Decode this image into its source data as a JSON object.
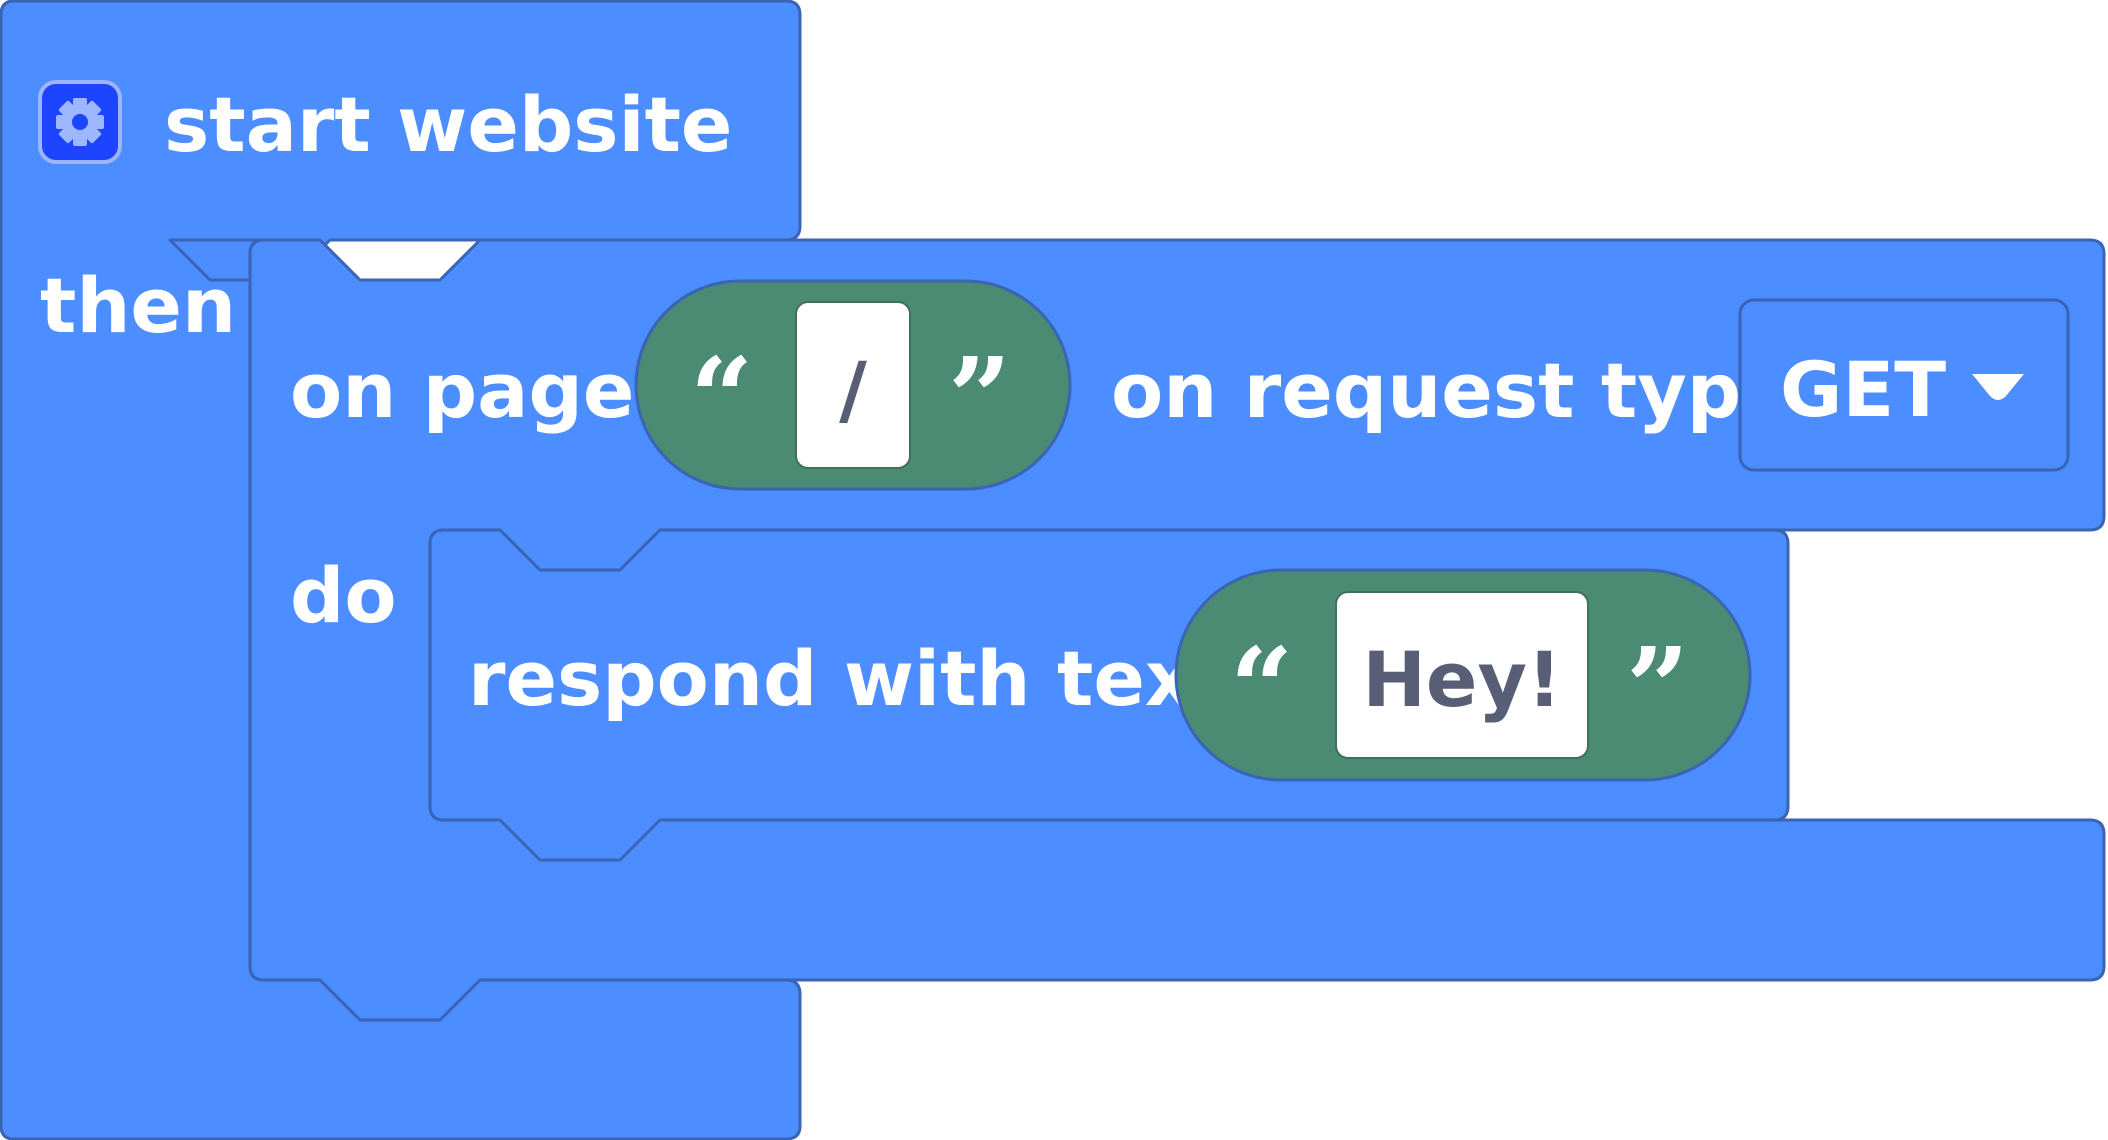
{
  "event_block": {
    "icon": "gear-icon",
    "title": "start website",
    "then_label": "then",
    "colors": {
      "block": "#4c8dff",
      "border": "#3a64b4",
      "icon_bg": "#1d45ff"
    }
  },
  "route_block": {
    "on_page_label": "on page",
    "page_value": "/",
    "on_request_type_label": "on request type",
    "request_type": "GET",
    "dropdown_icon": "caret-down-icon",
    "do_label": "do"
  },
  "respond_block": {
    "label": "respond with text",
    "text_value": "Hey!"
  },
  "string_pill": {
    "open_quote": "“",
    "close_quote": "”",
    "color": "#4b8a73",
    "value_text_color": "#575e75"
  }
}
